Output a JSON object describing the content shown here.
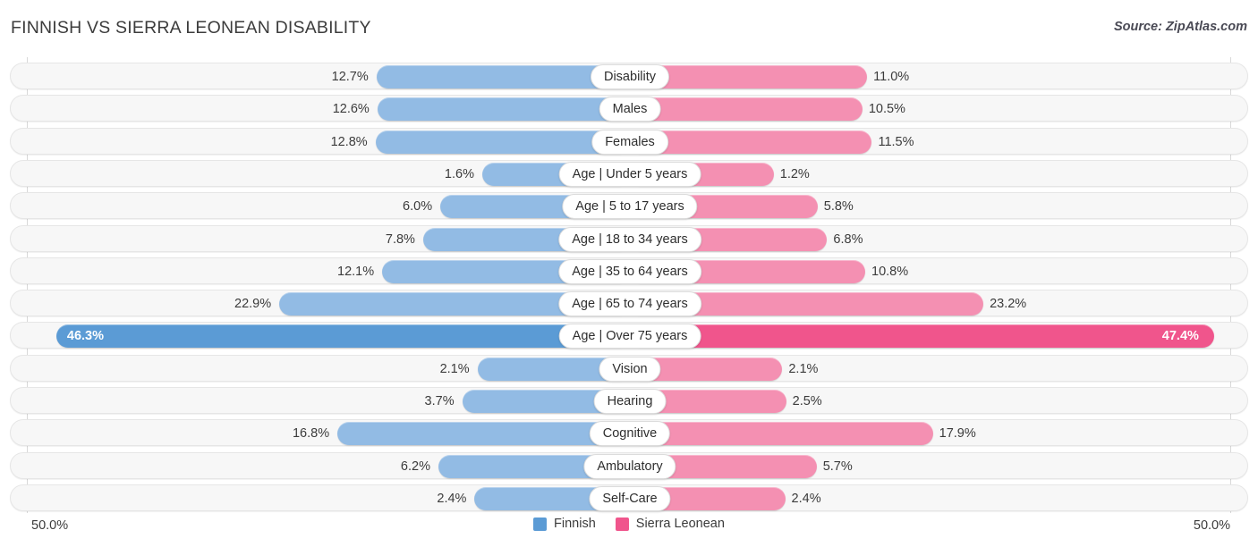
{
  "header": {
    "title": "FINNISH VS SIERRA LEONEAN DISABILITY",
    "source": "Source: ZipAtlas.com"
  },
  "footer": {
    "axis_left": "50.0%",
    "axis_right": "50.0%",
    "legend": [
      {
        "label": "Finnish",
        "color": "#5b9bd5"
      },
      {
        "label": "Sierra Leonean",
        "color": "#f0558c"
      }
    ]
  },
  "chart_data": {
    "type": "bar",
    "orientation": "diverging-horizontal",
    "title": "FINNISH VS SIERRA LEONEAN DISABILITY",
    "xlabel": "",
    "ylabel": "",
    "xlim": [
      -50.0,
      50.0
    ],
    "axis_tick_labels": [
      "50.0%",
      "50.0%"
    ],
    "grid": true,
    "legend_position": "bottom-center",
    "categories": [
      "Disability",
      "Males",
      "Females",
      "Age | Under 5 years",
      "Age | 5 to 17 years",
      "Age | 18 to 34 years",
      "Age | 35 to 64 years",
      "Age | 65 to 74 years",
      "Age | Over 75 years",
      "Vision",
      "Hearing",
      "Cognitive",
      "Ambulatory",
      "Self-Care"
    ],
    "series": [
      {
        "name": "Finnish",
        "color": "#92bbe4",
        "values": [
          12.7,
          12.6,
          12.8,
          1.6,
          6.0,
          7.8,
          12.1,
          22.9,
          46.3,
          2.1,
          3.7,
          16.8,
          6.2,
          2.4
        ],
        "labels": [
          "12.7%",
          "12.6%",
          "12.8%",
          "1.6%",
          "6.0%",
          "7.8%",
          "12.1%",
          "22.9%",
          "46.3%",
          "2.1%",
          "3.7%",
          "16.8%",
          "6.2%",
          "2.4%"
        ]
      },
      {
        "name": "Sierra Leonean",
        "color": "#f490b2",
        "values": [
          11.0,
          10.5,
          11.5,
          1.2,
          5.8,
          6.8,
          10.8,
          23.2,
          47.4,
          2.1,
          2.5,
          17.9,
          5.7,
          2.4
        ],
        "labels": [
          "11.0%",
          "10.5%",
          "11.5%",
          "1.2%",
          "5.8%",
          "6.8%",
          "10.8%",
          "23.2%",
          "47.4%",
          "2.1%",
          "2.5%",
          "17.9%",
          "5.7%",
          "2.4%"
        ]
      }
    ],
    "highlight_rows": [
      8
    ]
  }
}
